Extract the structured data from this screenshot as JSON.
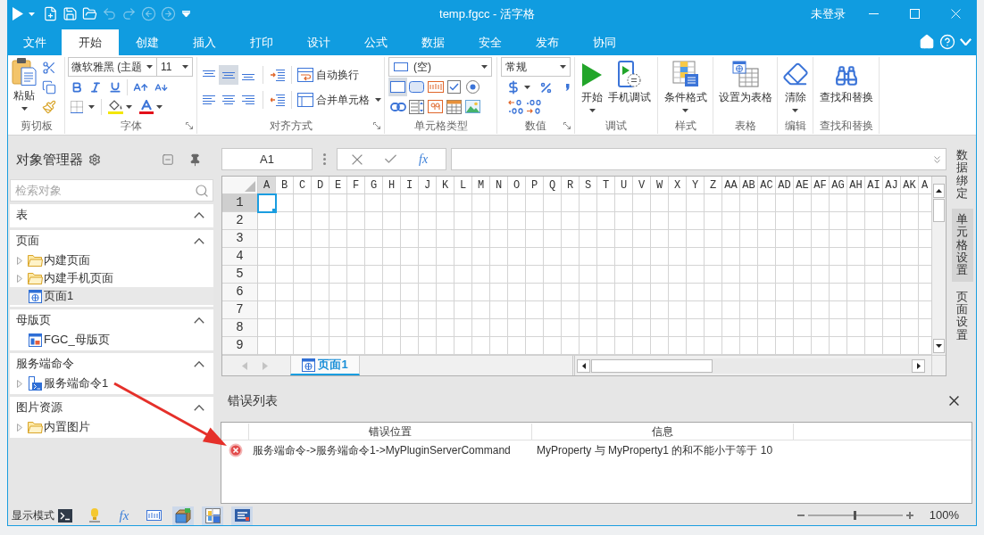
{
  "title_bar": {
    "quick_access": [
      {
        "kind": "run",
        "disabled": false
      },
      {
        "kind": "new",
        "disabled": false
      },
      {
        "kind": "save",
        "disabled": false
      },
      {
        "kind": "open",
        "disabled": false
      },
      {
        "kind": "undo",
        "disabled": true
      },
      {
        "kind": "redo",
        "disabled": true
      },
      {
        "kind": "back",
        "disabled": true
      },
      {
        "kind": "forward",
        "disabled": true
      },
      {
        "kind": "customize",
        "disabled": false
      }
    ],
    "title": "temp.fgcc - 活字格",
    "account": "未登录"
  },
  "menu_tabs": [
    {
      "label": "文件",
      "selected": false
    },
    {
      "label": "开始",
      "selected": true
    },
    {
      "label": "创建",
      "selected": false
    },
    {
      "label": "插入",
      "selected": false
    },
    {
      "label": "打印",
      "selected": false
    },
    {
      "label": "设计",
      "selected": false
    },
    {
      "label": "公式",
      "selected": false
    },
    {
      "label": "数据",
      "selected": false
    },
    {
      "label": "安全",
      "selected": false
    },
    {
      "label": "发布",
      "selected": false
    },
    {
      "label": "协同",
      "selected": false
    }
  ],
  "ribbon": {
    "clipboard": {
      "label": "剪切板",
      "paste": "粘贴"
    },
    "font": {
      "label": "字体",
      "launcher": true,
      "font_name": "微软雅黑 (主题",
      "font_size": "11"
    },
    "alignment": {
      "label": "对齐方式",
      "launcher": true,
      "vertical": [
        {
          "selected": false
        },
        {
          "selected": true
        },
        {
          "selected": false
        }
      ],
      "horizontal": [
        {
          "selected": false
        },
        {
          "selected": false
        },
        {
          "selected": false
        }
      ],
      "wrap": "自动换行",
      "merge": "合并单元格"
    },
    "cell_type": {
      "label": "单元格类型",
      "value": "(空)",
      "types": [
        {
          "kind": "label",
          "selected": true
        },
        {
          "kind": "button",
          "selected": false
        },
        {
          "kind": "textbox",
          "selected": false
        },
        {
          "kind": "checkbox",
          "selected": false
        },
        {
          "kind": "radio",
          "selected": false
        },
        {
          "kind": "link",
          "selected": false
        },
        {
          "kind": "list",
          "selected": false
        },
        {
          "kind": "number",
          "selected": false
        },
        {
          "kind": "table",
          "selected": false
        },
        {
          "kind": "image",
          "selected": false
        }
      ]
    },
    "number": {
      "label": "数值",
      "launcher": true,
      "format": "常规"
    },
    "debug": {
      "label": "调试",
      "start": "开始",
      "mobile": "手机调试"
    },
    "style": {
      "label": "样式",
      "conditional": "条件格式"
    },
    "table": {
      "label": "表格",
      "set_table": "设置为表格"
    },
    "edit": {
      "label": "编辑",
      "clear": "清除"
    },
    "find": {
      "label": "查找和替换",
      "find_replace": "查找和替换"
    }
  },
  "object_manager": {
    "title": "对象管理器",
    "search": {
      "placeholder": "检索对象"
    },
    "sections": [
      {
        "label": "表",
        "expanded": true
      },
      {
        "label": "页面",
        "expanded": true,
        "items": [
          {
            "label": "内建页面",
            "kind": "folder",
            "expanded": false,
            "selected": false
          },
          {
            "label": "内建手机页面",
            "kind": "folder",
            "expanded": false,
            "selected": false
          },
          {
            "label": "页面1",
            "kind": "page",
            "selected": true
          }
        ]
      },
      {
        "label": "母版页",
        "expanded": true,
        "items": [
          {
            "label": "FGC_母版页",
            "kind": "master",
            "selected": false
          }
        ]
      },
      {
        "label": "服务端命令",
        "expanded": true,
        "items": [
          {
            "label": "服务端命令1",
            "kind": "command",
            "expanded": false,
            "selected": false
          }
        ]
      },
      {
        "label": "图片资源",
        "expanded": true,
        "items": [
          {
            "label": "内置图片",
            "kind": "folder",
            "expanded": false,
            "selected": false
          }
        ]
      }
    ]
  },
  "formula_bar": {
    "name_box": "A1",
    "function_label": "fx"
  },
  "sheet": {
    "columns": [
      {
        "label": "A",
        "selected": true
      },
      {
        "label": "B",
        "selected": false
      },
      {
        "label": "C",
        "selected": false
      },
      {
        "label": "D",
        "selected": false
      },
      {
        "label": "E",
        "selected": false
      },
      {
        "label": "F",
        "selected": false
      },
      {
        "label": "G",
        "selected": false
      },
      {
        "label": "H",
        "selected": false
      },
      {
        "label": "I",
        "selected": false
      },
      {
        "label": "J",
        "selected": false
      },
      {
        "label": "K",
        "selected": false
      },
      {
        "label": "L",
        "selected": false
      },
      {
        "label": "M",
        "selected": false
      },
      {
        "label": "N",
        "selected": false
      },
      {
        "label": "O",
        "selected": false
      },
      {
        "label": "P",
        "selected": false
      },
      {
        "label": "Q",
        "selected": false
      },
      {
        "label": "R",
        "selected": false
      },
      {
        "label": "S",
        "selected": false
      },
      {
        "label": "T",
        "selected": false
      },
      {
        "label": "U",
        "selected": false
      },
      {
        "label": "V",
        "selected": false
      },
      {
        "label": "W",
        "selected": false
      },
      {
        "label": "X",
        "selected": false
      },
      {
        "label": "Y",
        "selected": false
      },
      {
        "label": "Z",
        "selected": false
      },
      {
        "label": "AA",
        "selected": false
      },
      {
        "label": "AB",
        "selected": false
      },
      {
        "label": "AC",
        "selected": false
      },
      {
        "label": "AD",
        "selected": false
      },
      {
        "label": "AE",
        "selected": false
      },
      {
        "label": "AF",
        "selected": false
      },
      {
        "label": "AG",
        "selected": false
      },
      {
        "label": "AH",
        "selected": false
      },
      {
        "label": "AI",
        "selected": false
      },
      {
        "label": "AJ",
        "selected": false
      },
      {
        "label": "AK",
        "selected": false
      },
      {
        "label": "A",
        "selected": false
      }
    ],
    "rows": [
      {
        "label": "1",
        "selected": true
      },
      {
        "label": "2",
        "selected": false
      },
      {
        "label": "3",
        "selected": false
      },
      {
        "label": "4",
        "selected": false
      },
      {
        "label": "5",
        "selected": false
      },
      {
        "label": "6",
        "selected": false
      },
      {
        "label": "7",
        "selected": false
      },
      {
        "label": "8",
        "selected": false
      },
      {
        "label": "9",
        "selected": false
      }
    ],
    "tabs": [
      {
        "label": "页面1",
        "selected": true
      }
    ]
  },
  "side_tabs": [
    {
      "label": "数据绑定",
      "selected": false
    },
    {
      "label": "单元格设置",
      "selected": true
    },
    {
      "label": "页面设置",
      "selected": false
    }
  ],
  "error_list": {
    "title": "错误列表",
    "columns": [
      "错误位置",
      "信息"
    ],
    "rows": [
      {
        "kind": "error",
        "location": "服务端命令->服务端命令1->MyPluginServerCommand",
        "message": "MyProperty 与 MyProperty1 的和不能小于等于 10"
      }
    ]
  },
  "status_bar": {
    "label": "显示模式",
    "modes": [
      {
        "kind": "terminal",
        "selected": false
      },
      {
        "kind": "lamp",
        "selected": false
      },
      {
        "kind": "formula",
        "label": "fx",
        "selected": false
      },
      {
        "kind": "textbox",
        "selected": false
      },
      {
        "kind": "package",
        "selected": true
      },
      {
        "kind": "table",
        "selected": true
      },
      {
        "kind": "list",
        "selected": true
      }
    ],
    "zoom": {
      "level": 0.5,
      "reading": "100%"
    }
  }
}
